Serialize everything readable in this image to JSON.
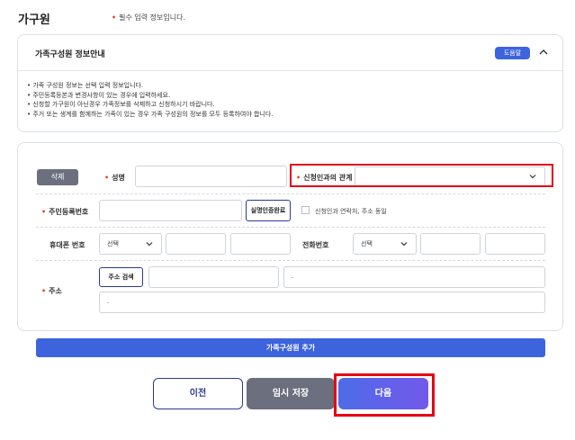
{
  "section": {
    "title": "가구원",
    "required_note": "필수 입력 정보입니다."
  },
  "info": {
    "title": "가족구성원 정보안내",
    "help_label": "도움말",
    "items": [
      "가족 구성원 정보는 선택 입력 정보입니다.",
      "주민등록등본과 변경사항이 있는 경우에 입력하세요.",
      "신청할 가구원이 아닌경우 가족정보를 삭제하고 신청하시기 바랍니다.",
      "주거 또는 생계를 함께하는 가족이 있는 경우 가족 구성원의 정보를 모두 등록하여야 합니다."
    ]
  },
  "form": {
    "delete_label": "삭제",
    "name_label": "성명",
    "name_value": "",
    "relation_label": "신청인과의 관계",
    "relation_value": "",
    "rrn_label": "주민등록번호",
    "rrn_value": "",
    "verify_label": "실명인증완료",
    "consent_label": "신청인과 연락처, 주소 동일",
    "mobile_label": "휴대폰 번호",
    "mobile_select": "선택",
    "phone_label": "전화번호",
    "phone_select": "선택",
    "address_label": "주소",
    "address_search_label": "주소 검색",
    "address_detail_1": ".",
    "address_detail_2": "."
  },
  "add_member_label": "가족구성원 추가",
  "nav": {
    "prev_label": "이전",
    "save_label": "임시 저장",
    "next_label": "다음"
  },
  "colors": {
    "required": "#e8421f",
    "primary": "#3d63dd",
    "gray_button": "#6b6f7e",
    "highlight": "#e60012"
  }
}
